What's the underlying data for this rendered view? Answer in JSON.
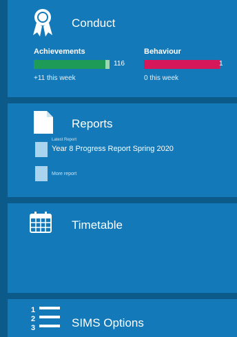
{
  "conduct": {
    "title": "Conduct",
    "icon": "award-ribbon-icon",
    "achievements": {
      "label": "Achievements",
      "value": "116",
      "sub": "+11 this week",
      "bar_color": "#1f9b58",
      "level": 0.91
    },
    "behaviour": {
      "label": "Behaviour",
      "value": "1",
      "sub": "0 this week",
      "bar_color": "#d6175a",
      "level": 1.0
    }
  },
  "reports": {
    "title": "Reports",
    "icon": "document-icon",
    "latest_label": "Latest Report",
    "latest_report": "Year 8 Progress Report Spring 2020",
    "more_label": "More report"
  },
  "timetable": {
    "title": "Timetable",
    "icon": "calendar-icon"
  },
  "sims": {
    "title": "SIMS Options",
    "icon": "numbered-list-icon"
  },
  "colors": {
    "background": "#0b5a8a",
    "card": "#1379b8",
    "text": "#ffffff"
  }
}
